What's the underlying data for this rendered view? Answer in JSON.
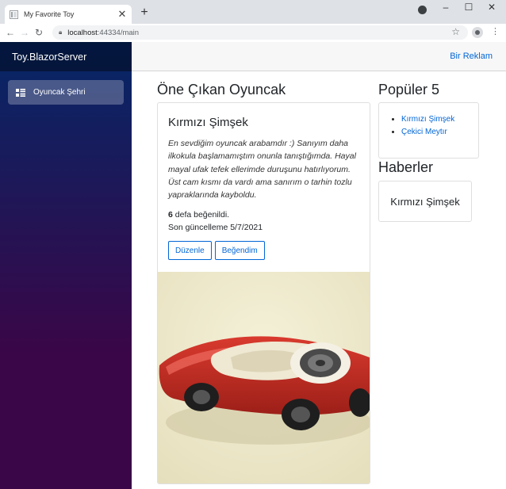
{
  "browser": {
    "tab_title": "My Favorite Toy",
    "tab_close": "✕",
    "new_tab": "+",
    "url_host": "localhost",
    "url_path": ":44334/main",
    "window_controls": {
      "minimize": "–",
      "maximize": "☐",
      "close": "✕"
    }
  },
  "app": {
    "brand": "Toy.BlazorServer",
    "nav": [
      {
        "label": "Oyuncak Şehri",
        "icon": "list-icon"
      }
    ],
    "topbar_link": "Bir Reklam"
  },
  "featured": {
    "heading": "Öne Çıkan Oyuncak",
    "title": "Kırmızı Şimşek",
    "description": "En sevdiğim oyuncak arabamdır :) Sanıyım daha ilkokula başlamamıştım onunla tanıştığımda. Hayal mayal ufak tefek ellerimde duruşunu hatırlıyorum. Üst cam kısmı da vardı ama sanırım o tarhin tozlu yapraklarında kayboldu.",
    "like_count": "6",
    "like_suffix": " defa beğenildi.",
    "last_update": "Son güncelleme 5/7/2021",
    "edit_button": "Düzenle",
    "like_button": "Beğendim"
  },
  "popular": {
    "heading": "Popüler 5",
    "items": [
      "Kırmızı Şimşek",
      "Çekici Meytır"
    ]
  },
  "news": {
    "heading": "Haberler",
    "item": "Kırmızı Şimşek"
  },
  "colors": {
    "link": "#0366d6",
    "sidebar_top": "#052767",
    "sidebar_bottom": "#3a0647"
  }
}
